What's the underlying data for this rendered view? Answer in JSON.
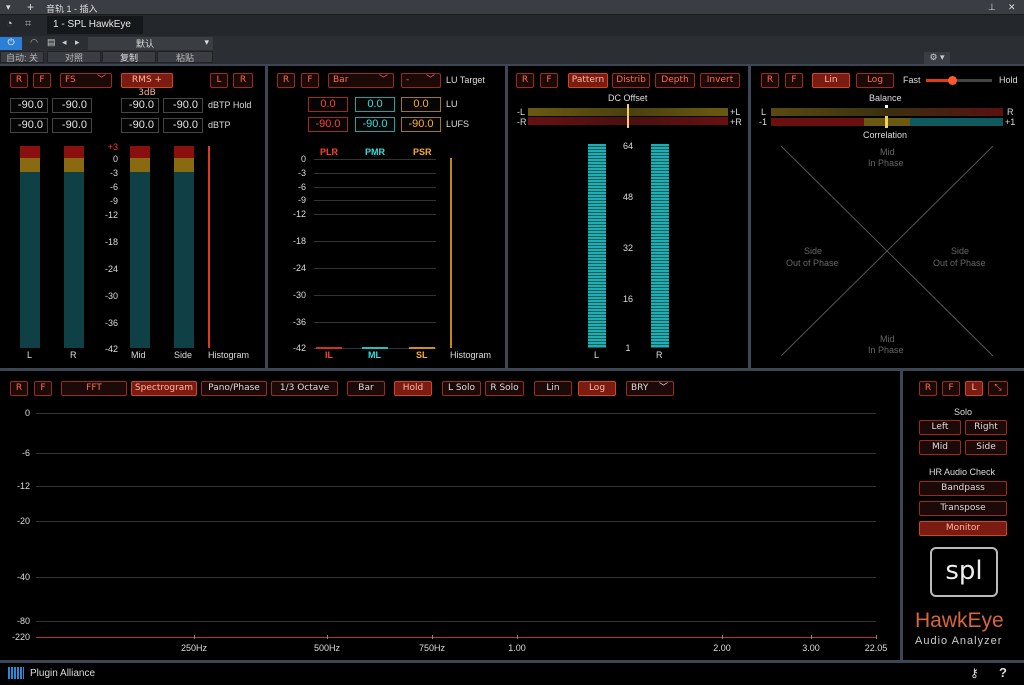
{
  "title_bar": {
    "text": "音轨 1 - 插入",
    "pin_icon": "pin-icon",
    "close_icon": "close-icon"
  },
  "header": {
    "tab": "1 - SPL HawkEye"
  },
  "toolbar": {
    "auto_label": "自动: 关",
    "compare_label": "对照",
    "copy_label": "复制",
    "paste_label": "粘贴",
    "preset": "默认"
  },
  "level": {
    "btn_r": "R",
    "btn_f": "F",
    "scale": "FS",
    "rms": "RMS + 3dB",
    "btn_l2": "L",
    "btn_r2": "R",
    "hold_l": "-90.0",
    "hold_r": "-90.0",
    "hold_m": "-90.0",
    "hold_s": "-90.0",
    "hold_label": "dBTP Hold",
    "tp_l": "-90.0",
    "tp_r": "-90.0",
    "tp_m": "-90.0",
    "tp_s": "-90.0",
    "tp_label": "dBTP",
    "ticks": [
      "+3",
      "0",
      "-3",
      "-6",
      "-9",
      "-12",
      "-18",
      "-24",
      "-30",
      "-36",
      "-42"
    ],
    "ch_l": "L",
    "ch_r": "R",
    "ch_mid": "Mid",
    "ch_side": "Side",
    "histogram": "Histogram"
  },
  "loudness": {
    "btn_r": "R",
    "btn_f": "F",
    "mode": "Bar",
    "target": "-",
    "target_label": "LU Target",
    "lu_1": "0.0",
    "lu_2": "0.0",
    "lu_3": "0.0",
    "lu_label": "LU",
    "lufs_1": "-90.0",
    "lufs_2": "-90.0",
    "lufs_3": "-90.0",
    "lufs_label": "LUFS",
    "plr": "PLR",
    "pmr": "PMR",
    "psr": "PSR",
    "ticks": [
      "0",
      "-3",
      "-6",
      "-9",
      "-12",
      "-18",
      "-24",
      "-30",
      "-36",
      "-42"
    ],
    "il": "IL",
    "ml": "ML",
    "sl": "SL",
    "histogram": "Histogram"
  },
  "dc": {
    "btn_r": "R",
    "btn_f": "F",
    "pattern": "Pattern",
    "distrib": "Distrib",
    "depth": "Depth",
    "invert": "Invert",
    "title": "DC Offset",
    "neg_l": "-L",
    "pos_l": "+L",
    "neg_r": "-R",
    "pos_r": "+R",
    "ticks": [
      "64",
      "48",
      "32",
      "16",
      "1"
    ],
    "ch_l": "L",
    "ch_r": "R"
  },
  "phase": {
    "btn_r": "R",
    "btn_f": "F",
    "lin": "Lin",
    "log": "Log",
    "fast": "Fast",
    "hold": "Hold",
    "balance": "Balance",
    "bal_l": "L",
    "bal_r": "R",
    "cor_neg": "-1",
    "cor_pos": "+1",
    "correlation": "Correlation",
    "mid_top1": "Mid",
    "mid_top2": "In Phase",
    "side_l1": "Side",
    "side_l2": "Out of Phase",
    "side_r1": "Side",
    "side_r2": "Out of Phase",
    "mid_bot1": "Mid",
    "mid_bot2": "In Phase"
  },
  "spectrum": {
    "btn_r": "R",
    "btn_f": "F",
    "fft": "FFT",
    "spectrogram": "Spectrogram",
    "pano": "Pano/Phase",
    "octave": "1/3 Octave",
    "bar": "Bar",
    "hold": "Hold",
    "lsolo": "L Solo",
    "rsolo": "R Solo",
    "lin": "Lin",
    "log": "Log",
    "palette": "BRY",
    "yticks": [
      "0",
      "-6",
      "-12",
      "-20",
      "-40",
      "-80",
      "-220"
    ],
    "xticks": [
      "250Hz",
      "500Hz",
      "750Hz",
      "1.00",
      "2.00",
      "3.00",
      "22.05"
    ]
  },
  "side": {
    "btn_r": "R",
    "btn_f": "F",
    "btn_l": "L",
    "solo": "Solo",
    "left": "Left",
    "right": "Right",
    "mid": "Mid",
    "side": "Side",
    "hr": "HR Audio Check",
    "bandpass": "Bandpass",
    "transpose": "Transpose",
    "monitor": "Monitor",
    "logo": "spl",
    "brand": "HawkEye",
    "sub": "Audio Analyzer"
  },
  "footer": {
    "vendor": "Plugin Alliance",
    "help": "?"
  }
}
